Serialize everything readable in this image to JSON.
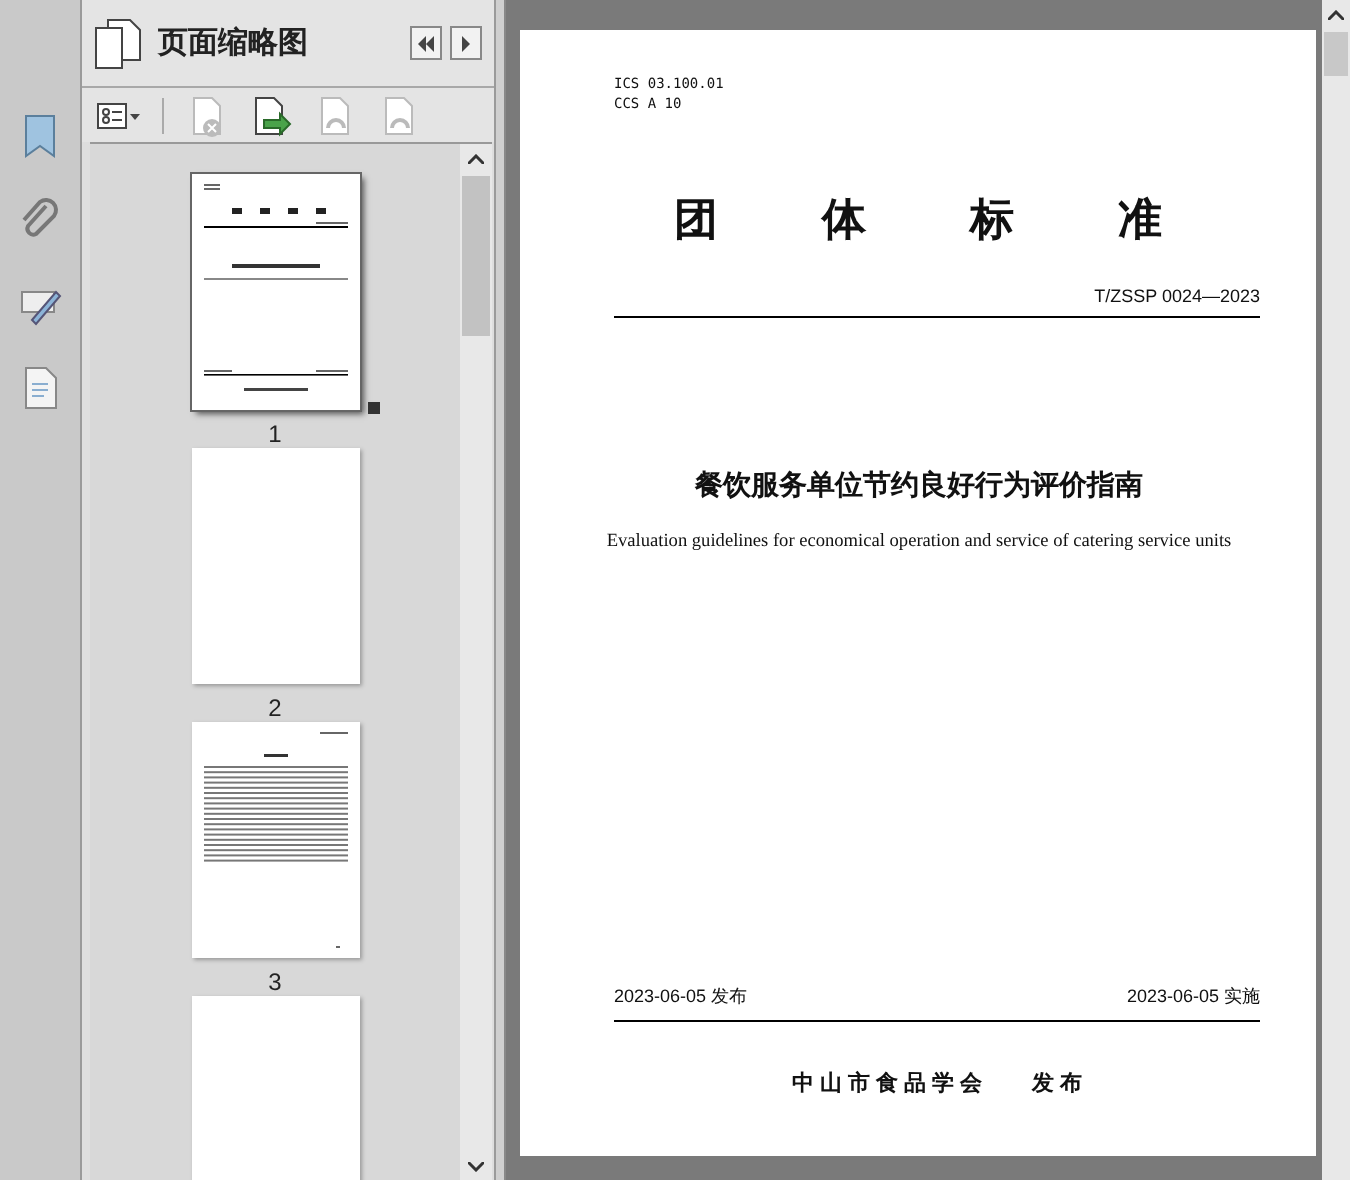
{
  "panel": {
    "title": "页面缩略图"
  },
  "rail": [
    {
      "kind": "bookmark"
    },
    {
      "kind": "attachment"
    },
    {
      "kind": "signature"
    },
    {
      "kind": "layers"
    }
  ],
  "toolbar": [
    {
      "kind": "options",
      "disabled": false
    },
    {
      "kind": "delete",
      "disabled": true
    },
    {
      "kind": "insert",
      "disabled": false
    },
    {
      "kind": "rotate-left",
      "disabled": true
    },
    {
      "kind": "rotate-right",
      "disabled": true
    }
  ],
  "thumbnails": [
    {
      "kind": "cover",
      "label": "1",
      "selected": true
    },
    {
      "kind": "blank",
      "label": "2",
      "selected": false
    },
    {
      "kind": "text",
      "label": "3",
      "selected": false
    },
    {
      "kind": "blank",
      "selected": false
    }
  ],
  "document": {
    "codes": [
      "ICS 03.100.01",
      "CCS A 10"
    ],
    "heading": "团体标准",
    "number": "T/ZSSP 0024—2023",
    "title_zh": "餐饮服务单位节约良好行为评价指南",
    "title_en": "Evaluation guidelines for economical operation and service of catering service units",
    "issued": "2023-06-05 发布",
    "effective": "2023-06-05 实施",
    "publisher": "中山市食品学会",
    "publish_word": "发 布"
  }
}
